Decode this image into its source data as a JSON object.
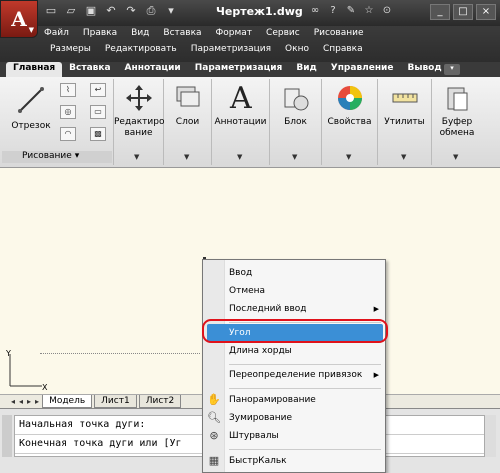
{
  "app": {
    "title": "Чертеж1.dwg",
    "logo": "A"
  },
  "quick_access": [
    "new-icon",
    "open-icon",
    "save-icon",
    "undo-icon",
    "redo-icon",
    "print-icon",
    "dropdown-icon"
  ],
  "title_tools": [
    "binoculars-icon",
    "help-icon",
    "star-icon",
    "search-icon"
  ],
  "window_controls": [
    "_",
    "□",
    "×"
  ],
  "menu": {
    "row1": [
      "Файл",
      "Правка",
      "Вид",
      "Вставка",
      "Формат",
      "Сервис",
      "Рисование"
    ],
    "row2": [
      "Размеры",
      "Редактировать",
      "Параметризация",
      "Окно",
      "Справка"
    ]
  },
  "tabs": [
    "Главная",
    "Вставка",
    "Аннотации",
    "Параметризация",
    "Вид",
    "Управление",
    "Вывод"
  ],
  "ribbon": {
    "line_label": "Отрезок",
    "draw_footer": "Рисование",
    "edit_label": "Редактиро\nвание",
    "layers_label": "Слои",
    "annot_label": "Аннотации",
    "block_label": "Блок",
    "props_label": "Свойства",
    "utils_label": "Утилиты",
    "clipboard_label": "Буфер\nобмена"
  },
  "layout_tabs": [
    "Модель",
    "Лист1",
    "Лист2"
  ],
  "command": {
    "line1": "Начальная точка дуги:",
    "line2": "Конечная точка дуги или [Уг"
  },
  "context_menu": {
    "items": [
      {
        "label": "Ввод"
      },
      {
        "label": "Отмена"
      },
      {
        "label": "Последний ввод",
        "submenu": "▶"
      },
      {
        "label": "Угол",
        "highlighted": true
      },
      {
        "label": "Длина хорды"
      },
      {
        "label": "Переопределение привязок",
        "submenu": "▶"
      },
      {
        "label": "Панорамирование",
        "icon": "pan-icon"
      },
      {
        "label": "Зумирование",
        "icon": "zoom-icon"
      },
      {
        "label": "Штурвалы",
        "icon": "steeringwheel-icon"
      },
      {
        "label": "БыстрКальк",
        "icon": "calculator-icon"
      }
    ]
  },
  "colors": {
    "highlight": "#3b8fd6",
    "annotation_ring": "#e0121b",
    "canvas": "#fcf9ea"
  }
}
